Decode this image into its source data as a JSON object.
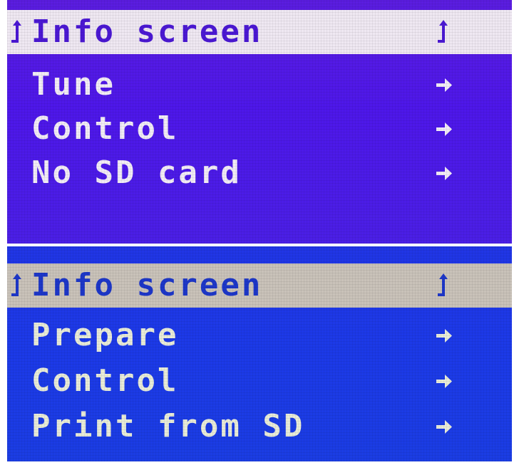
{
  "colors": {
    "top_background": "#4e17ea",
    "bottom_background": "#1c3ae8",
    "top_highlight": "#efe8f2",
    "bottom_highlight": "#c9c2b9",
    "text_light": "#f2ecf6"
  },
  "top_menu": {
    "items": [
      {
        "label": "Info screen",
        "icon": "back-icon",
        "selected": true
      },
      {
        "label": "Tune",
        "icon": "arrow-right-icon"
      },
      {
        "label": "Control",
        "icon": "arrow-right-icon"
      },
      {
        "label": "No SD card",
        "icon": "arrow-right-icon"
      }
    ]
  },
  "bottom_menu": {
    "items": [
      {
        "label": "Info screen",
        "icon": "back-icon",
        "selected": true
      },
      {
        "label": "Prepare",
        "icon": "arrow-right-icon"
      },
      {
        "label": "Control",
        "icon": "arrow-right-icon"
      },
      {
        "label": "Print from SD",
        "icon": "arrow-right-icon"
      }
    ]
  }
}
